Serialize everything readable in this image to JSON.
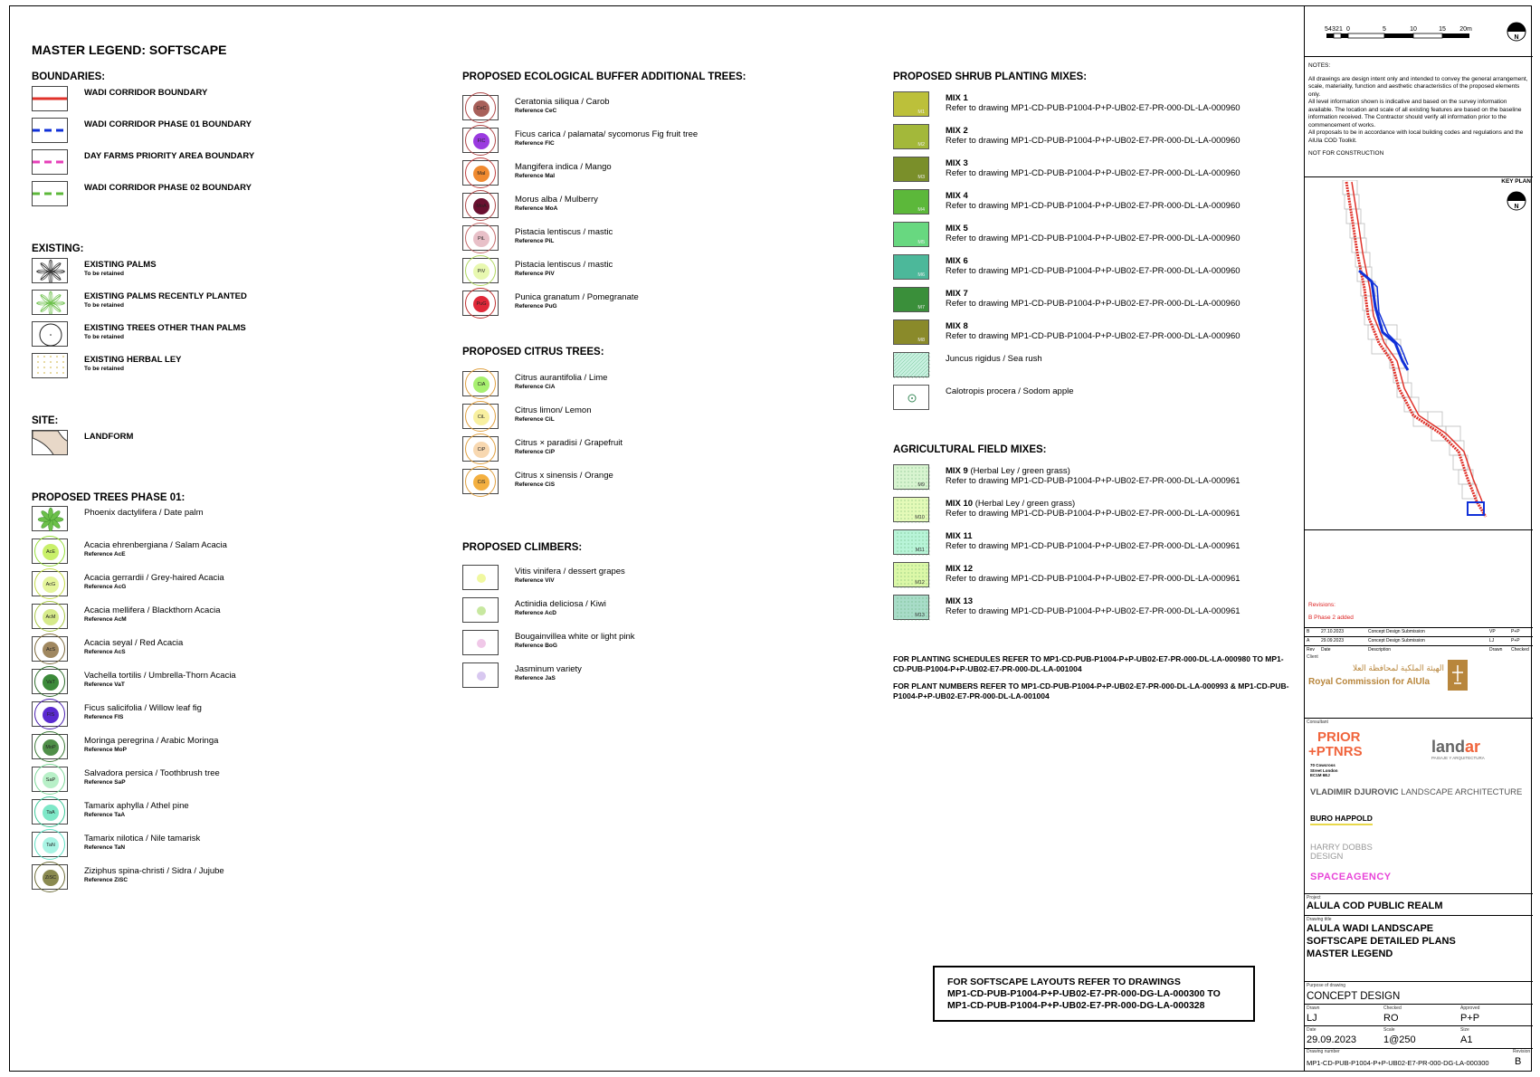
{
  "legend_title": "MASTER LEGEND: SOFTSCAPE",
  "boundaries": {
    "heading": "BOUNDARIES:",
    "items": [
      {
        "label": "WADI CORRIDOR BOUNDARY",
        "color": "#e0322a",
        "style": "solid"
      },
      {
        "label": "WADI CORRIDOR PHASE 01 BOUNDARY",
        "color": "#1030d8",
        "style": "dashed"
      },
      {
        "label": "DAY FARMS PRIORITY AREA BOUNDARY",
        "color": "#e63fb8",
        "style": "dashed"
      },
      {
        "label": "WADI CORRIDOR PHASE 02 BOUNDARY",
        "color": "#5cb83a",
        "style": "dashed"
      }
    ]
  },
  "existing": {
    "heading": "EXISTING:",
    "items": [
      {
        "label": "EXISTING PALMS",
        "sub": "To be retained",
        "icon": "palm-icon"
      },
      {
        "label": "EXISTING PALMS RECENTLY PLANTED",
        "sub": "To be retained",
        "icon": "palm-light-icon"
      },
      {
        "label": "EXISTING TREES OTHER THAN PALMS",
        "sub": "To be retained",
        "icon": "tree-circle-icon"
      },
      {
        "label": "EXISTING HERBAL LEY",
        "sub": "To be retained",
        "icon": "dotted-hatch-icon"
      }
    ]
  },
  "site": {
    "heading": "SITE:",
    "items": [
      {
        "label": "LANDFORM",
        "color": "#e8d8c8"
      }
    ]
  },
  "phase01": {
    "heading": "PROPOSED TREES PHASE 01:",
    "items": [
      {
        "name": "Phoenix dactylifera / Date palm",
        "ref": "",
        "code": "",
        "color": "#6cc04a",
        "palm": true
      },
      {
        "name": "Acacia ehrenbergiana / Salam Acacia",
        "ref": "Reference AcE",
        "code": "AcE",
        "color": "#c9f06a",
        "halo": "#98e03c"
      },
      {
        "name": "Acacia gerrardii / Grey-haired Acacia",
        "ref": "Reference AcG",
        "code": "AcG",
        "color": "#e5f59a",
        "halo": "#c5dc4a"
      },
      {
        "name": "Acacia mellifera / Blackthorn Acacia",
        "ref": "Reference AcM",
        "code": "AcM",
        "color": "#d6ea8a",
        "halo": "#a9c846"
      },
      {
        "name": "Acacia seyal / Red Acacia",
        "ref": "Reference AcS",
        "code": "AcS",
        "color": "#a08860",
        "halo": "#7d6b3e"
      },
      {
        "name": "Vachella tortilis / Umbrella-Thorn Acacia",
        "ref": "Reference VaT",
        "code": "VaT",
        "color": "#3c8a3a",
        "halo": "#2f6d2c"
      },
      {
        "name": "Ficus salicifolia / Willow leaf fig",
        "ref": "Reference FIS",
        "code": "FIS",
        "color": "#5a2ad0",
        "halo": "#4a1fb0"
      },
      {
        "name": "Moringa peregrina / Arabic Moringa",
        "ref": "Reference MoP",
        "code": "MoP",
        "color": "#4f8f48",
        "halo": "#3d7a38"
      },
      {
        "name": "Salvadora persica / Toothbrush tree",
        "ref": "Reference SaP",
        "code": "SaP",
        "color": "#b8f0c8",
        "halo": "#7ed89a"
      },
      {
        "name": "Tamarix aphylla / Athel pine",
        "ref": "Reference TaA",
        "code": "TaA",
        "color": "#7ee8c8",
        "halo": "#3fc99a"
      },
      {
        "name": "Tamarix nilotica / Nile tamarisk",
        "ref": "Reference TaN",
        "code": "TaN",
        "color": "#a8f4e4",
        "halo": "#5ee0c4"
      },
      {
        "name": "Ziziphus spina-christi / Sidra / Jujube",
        "ref": "Reference ZiSC",
        "code": "ZiSC",
        "color": "#8a8a50",
        "halo": "#6e6e3a"
      }
    ]
  },
  "buffer": {
    "heading": "PROPOSED ECOLOGICAL BUFFER ADDITIONAL TREES:",
    "items": [
      {
        "name": "Ceratonia siliqua / Carob",
        "ref": "Reference CeC",
        "code": "CeC",
        "color": "#a8605a",
        "halo": "#b04848"
      },
      {
        "name": "Ficus carica / palamata/ sycomorus Fig fruit tree",
        "ref": "Reference FIC",
        "code": "FIC",
        "color": "#9a3ae0",
        "halo": "#b04848"
      },
      {
        "name": "Mangifera indica / Mango",
        "ref": "Reference MaI",
        "code": "MaI",
        "color": "#f08a30",
        "halo": "#c04040"
      },
      {
        "name": "Morus alba / Mulberry",
        "ref": "Reference MoA",
        "code": "MoA",
        "color": "#6a1030",
        "halo": "#b04848"
      },
      {
        "name": "Pistacia lentiscus / mastic",
        "ref": "Reference PiL",
        "code": "PiL",
        "color": "#e8c0c8",
        "halo": "#c46a6a"
      },
      {
        "name": "Pistacia lentiscus / mastic",
        "ref": "Reference PiV",
        "code": "PiV",
        "color": "#e8f8b0",
        "halo": "#b0d860"
      },
      {
        "name": "Punica granatum / Pomegranate",
        "ref": "Reference PuG",
        "code": "PuG",
        "color": "#e02838",
        "halo": "#c03030"
      }
    ]
  },
  "citrus": {
    "heading": "PROPOSED CITRUS TREES:",
    "items": [
      {
        "name": "Citrus aurantifolia / Lime",
        "ref": "Reference CiA",
        "code": "CiA",
        "color": "#a8f070",
        "halo": "#e0a040"
      },
      {
        "name": "Citrus limon/ Lemon",
        "ref": "Reference CiL",
        "code": "CiL",
        "color": "#f8f0a0",
        "halo": "#e0a040"
      },
      {
        "name": "Citrus × paradisi / Grapefruit",
        "ref": "Reference CiP",
        "code": "CiP",
        "color": "#f8d8b0",
        "halo": "#e0a040"
      },
      {
        "name": "Citrus x sinensis / Orange",
        "ref": "Reference CiS",
        "code": "CiS",
        "color": "#f4b040",
        "halo": "#e0a040"
      }
    ]
  },
  "climbers": {
    "heading": "PROPOSED CLIMBERS:",
    "items": [
      {
        "name": "Vitis vinifera / dessert grapes",
        "ref": "Reference ViV",
        "code": "ViV",
        "color": "#f0f8a0"
      },
      {
        "name": "Actinidia deliciosa / Kiwi",
        "ref": "Reference AcD",
        "code": "AcD",
        "color": "#c8e8a0"
      },
      {
        "name": "Bougainvillea white or light pink",
        "ref": "Reference BoG",
        "code": "BoG",
        "color": "#f0c8e8"
      },
      {
        "name": "Jasminum variety",
        "ref": "Reference JaS",
        "code": "JaS",
        "color": "#d8c8f0"
      }
    ]
  },
  "shrubs": {
    "heading": "PROPOSED SHRUB PLANTING MIXES:",
    "items": [
      {
        "title": "MIX 1",
        "desc": "Refer to drawing MP1-CD-PUB-P1004-P+P-UB02-E7-PR-000-DL-LA-000960",
        "code": "M1",
        "color": "#bcc03a"
      },
      {
        "title": "MIX 2",
        "desc": "Refer to drawing MP1-CD-PUB-P1004-P+P-UB02-E7-PR-000-DL-LA-000960",
        "code": "M2",
        "color": "#a3b83a"
      },
      {
        "title": "MIX 3",
        "desc": "Refer to drawing MP1-CD-PUB-P1004-P+P-UB02-E7-PR-000-DL-LA-000960",
        "code": "M3",
        "color": "#7a8f2a"
      },
      {
        "title": "MIX 4",
        "desc": "Refer to drawing MP1-CD-PUB-P1004-P+P-UB02-E7-PR-000-DL-LA-000960",
        "code": "M4",
        "color": "#5cb83a"
      },
      {
        "title": "MIX 5",
        "desc": "Refer to drawing MP1-CD-PUB-P1004-P+P-UB02-E7-PR-000-DL-LA-000960",
        "code": "M5",
        "color": "#68d880"
      },
      {
        "title": "MIX 6",
        "desc": "Refer to drawing MP1-CD-PUB-P1004-P+P-UB02-E7-PR-000-DL-LA-000960",
        "code": "M6",
        "color": "#4cb89a"
      },
      {
        "title": "MIX 7",
        "desc": "Refer to drawing MP1-CD-PUB-P1004-P+P-UB02-E7-PR-000-DL-LA-000960",
        "code": "M7",
        "color": "#3a8f3a"
      },
      {
        "title": "MIX 8",
        "desc": "Refer to drawing MP1-CD-PUB-P1004-P+P-UB02-E7-PR-000-DL-LA-000960",
        "code": "M8",
        "color": "#8a8a2a"
      }
    ],
    "extra": [
      {
        "title": "Juncus rigidus / Sea rush",
        "color": "#c8f0e0"
      },
      {
        "title": "Calotropis procera / Sodom apple",
        "color": "#ffffff"
      }
    ]
  },
  "agri": {
    "heading": "AGRICULTURAL FIELD MIXES:",
    "items": [
      {
        "title": "MIX 9",
        "note": " (Herbal Ley  / green grass)",
        "desc": "Refer to drawing MP1-CD-PUB-P1004-P+P-UB02-E7-PR-000-DL-LA-000961",
        "code": "M9",
        "color": "#d8f4d0"
      },
      {
        "title": "MIX 10",
        "note": " (Herbal Ley  / green grass)",
        "desc": "Refer to drawing MP1-CD-PUB-P1004-P+P-UB02-E7-PR-000-DL-LA-000961",
        "code": "M10",
        "color": "#e4fab8"
      },
      {
        "title": "MIX 11",
        "note": "",
        "desc": "Refer to drawing MP1-CD-PUB-P1004-P+P-UB02-E7-PR-000-DL-LA-000961",
        "code": "M11",
        "color": "#b8f4d8"
      },
      {
        "title": "MIX 12",
        "note": "",
        "desc": "Refer to drawing MP1-CD-PUB-P1004-P+P-UB02-E7-PR-000-DL-LA-000961",
        "code": "M12",
        "color": "#dcf8a8"
      },
      {
        "title": "MIX 13",
        "note": "",
        "desc": "Refer to drawing MP1-CD-PUB-P1004-P+P-UB02-E7-PR-000-DL-LA-000961",
        "code": "M13",
        "color": "#a8dcc8"
      }
    ]
  },
  "notes_main": {
    "planting": "FOR PLANTING SCHEDULES REFER TO MP1-CD-PUB-P1004-P+P-UB02-E7-PR-000-DL-LA-000980 TO MP1-CD-PUB-P1004-P+P-UB02-E7-PR-000-DL-LA-001004",
    "plant_numbers": "FOR PLANT NUMBERS REFER TO MP1-CD-PUB-P1004-P+P-UB02-E7-PR-000-DL-LA-000993 & MP1-CD-PUB-P1004-P+P-UB02-E7-PR-000-DL-LA-001004"
  },
  "layout_ref": {
    "line1": "FOR SOFTSCAPE LAYOUTS REFER TO DRAWINGS",
    "line2": "MP1-CD-PUB-P1004-P+P-UB02-E7-PR-000-DG-LA-000300 TO",
    "line3": "MP1-CD-PUB-P1004-P+P-UB02-E7-PR-000-DG-LA-000328"
  },
  "sidebar": {
    "scale_ticks": [
      "5",
      "4",
      "3",
      "2",
      "1",
      "0",
      "5",
      "10",
      "15",
      "20m"
    ],
    "north": "N",
    "notes_heading": "NOTES:",
    "notes": [
      "All drawings are design intent only and intended to convey the general arrangement, scale, materiality, function and aesthetic characteristics of the proposed elements only.",
      "All level information shown is indicative and based on the survey information available. The location and scale of all existing features are based on the baseline information received. The Contractor should verify all information prior to the commencement of works.",
      "All proposals to be in accordance with local building codes and regulations and the AlUla COD Toolkit."
    ],
    "not_for_construction": "NOT FOR CONSTRUCTION",
    "key_plan": "KEY PLAN",
    "revisions_heading": "Revisions:",
    "revision_note": "B    Phase 2 added",
    "rev_rows": [
      {
        "rev": "B",
        "date": "27.10.2023",
        "desc": "Concept Design Submission",
        "drawn": "VP",
        "checked": "P+P"
      },
      {
        "rev": "A",
        "date": "29.09.2023",
        "desc": "Concept Design Submission",
        "drawn": "LJ",
        "checked": "P+P"
      }
    ],
    "rev_header": {
      "rev": "Rev",
      "date": "Date",
      "desc": "Description",
      "drawn": "Drawn",
      "checked": "Checked"
    },
    "client_label": "Client",
    "client_ar": "الهيئة الملكية لمحافظة العلا",
    "client_en": "Royal Commission for AlUla",
    "consultant_label": "Consultant",
    "prior_1": "PRIOR",
    "prior_2": "+PTNRS",
    "prior_addr": "70 Cowcross Street London EC1M 6EJ",
    "landar": "land",
    "landar_2": "ar",
    "landar_sub": "PAISAJE Y ARQUITECTURA",
    "vdla_1": "VLADIMIR DJUROVIC",
    "vdla_2": " LANDSCAPE ARCHITECTURE",
    "buro": "BURO HAPPOLD",
    "hdd": "HARRY DOBBS DESIGN",
    "space": "SPACEAGENCY",
    "project_label": "Project",
    "project": "ALULA COD PUBLIC REALM",
    "drawing_title_label": "Drawing title",
    "drawing_title": [
      "ALULA WADI LANDSCAPE",
      "SOFTSCAPE DETAILED PLANS",
      "MASTER LEGEND"
    ],
    "purpose_label": "Purpose of drawing",
    "purpose": "CONCEPT DESIGN",
    "drawn_label": "Drawn",
    "drawn": "LJ",
    "checked_label": "Checked",
    "checked": "RO",
    "approved_label": "Approved",
    "approved": "P+P",
    "date_label": "Date",
    "date": "29.09.2023",
    "scale_label": "Scale",
    "scale": "1@250",
    "size_label": "Size",
    "size": "A1",
    "number_label": "Drawing number",
    "number": "MP1-CD-PUB-P1004-P+P-UB02-E7-PR-000-DG-LA-000300",
    "revision_label": "Revision",
    "revision": "B"
  }
}
